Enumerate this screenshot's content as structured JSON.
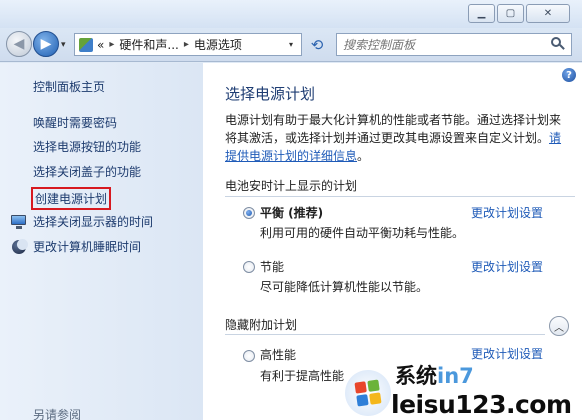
{
  "window": {
    "minimize_glyph": "▁",
    "maximize_glyph": "▢",
    "close_glyph": "✕"
  },
  "nav": {
    "back_glyph": "◀",
    "forward_glyph": "▶",
    "dropdown_glyph": "▾",
    "breadcrumb_prefix": "«",
    "breadcrumbs": [
      "硬件和声...",
      "电源选项"
    ],
    "breadcrumb_separator": "▸",
    "refresh_glyph": "⟲",
    "search_placeholder": "搜索控制面板"
  },
  "sidebar": {
    "home_link": "控制面板主页",
    "links": [
      "唤醒时需要密码",
      "选择电源按钮的功能",
      "选择关闭盖子的功能",
      "创建电源计划",
      "选择关闭显示器的时间",
      "更改计算机睡眠时间"
    ],
    "see_also": "另请参阅",
    "highlight_color": "#d71920"
  },
  "main": {
    "help_glyph": "?",
    "title": "选择电源计划",
    "description": "电源计划有助于最大化计算机的性能或者节能。通过选择计划来将其激活，或选择计划并通过更改其电源设置来自定义计划。",
    "description_link": "请提供电源计划的详细信息",
    "description_end": "。",
    "battery_group_title": "电池安时计上显示的计划",
    "hidden_group_title": "隐藏附加计划",
    "collapse_glyph": "︿",
    "plans": [
      {
        "name": "平衡 (推荐)",
        "description": "利用可用的硬件自动平衡功耗与性能。",
        "change_link": "更改计划设置",
        "selected": true
      },
      {
        "name": "节能",
        "description": "尽可能降低计算机性能以节能。",
        "change_link": "更改计划设置",
        "selected": false
      },
      {
        "name": "高性能",
        "description": "有利于提高性能",
        "change_link": "更改计划设置",
        "selected": false
      }
    ],
    "link_color": "#1f5bb8"
  },
  "watermark": {
    "site_cn": "系统",
    "site_cn_tail": "in7",
    "site_url": "leisu123.com",
    "logo_colors": [
      "#e8462b",
      "#6bb33a",
      "#2f7fd8",
      "#f4b71c"
    ]
  }
}
